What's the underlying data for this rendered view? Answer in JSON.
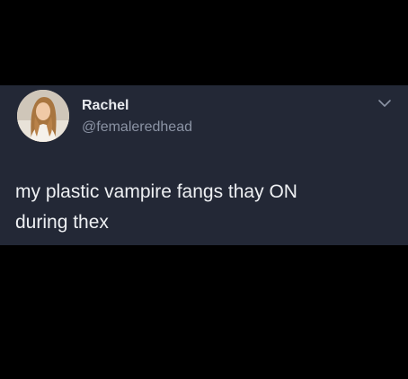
{
  "tweet": {
    "display_name": "Rachel",
    "handle": "@femaleredhead",
    "text": "my plastic vampire fangs thay ON\nduring thex"
  },
  "icons": {
    "avatar": "profile-photo",
    "more": "chevron-down-icon"
  },
  "colors": {
    "background": "#000000",
    "card": "#232836",
    "name": "#e9ebef",
    "handle": "#8b93a4",
    "text": "#eef0f3"
  }
}
